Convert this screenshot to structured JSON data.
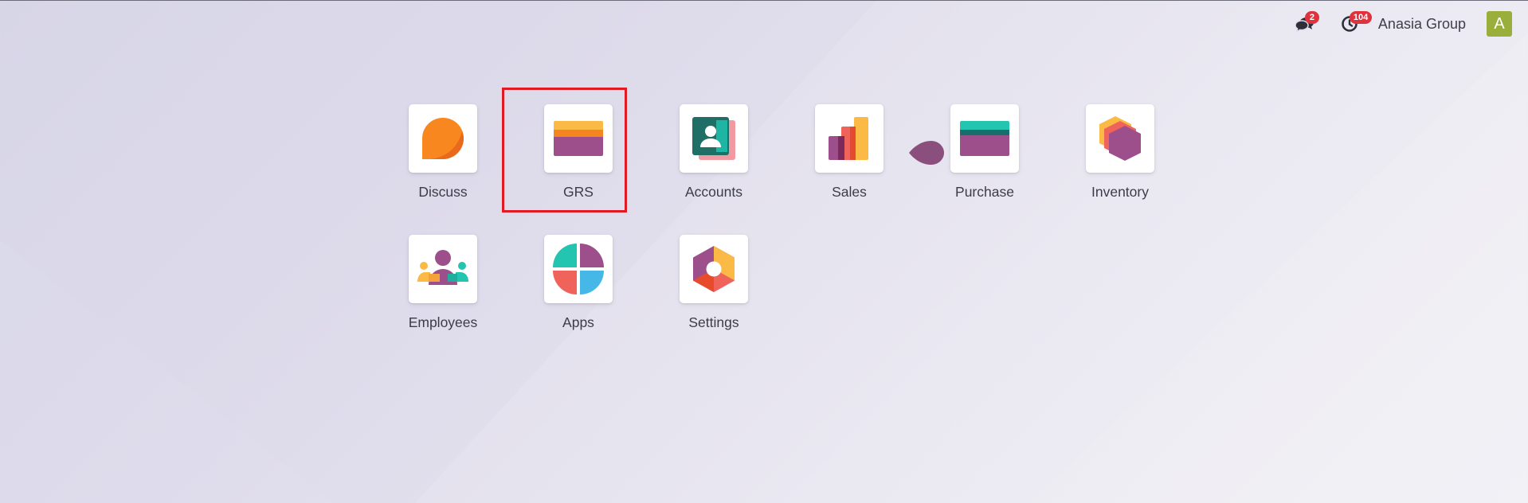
{
  "systray": {
    "messages_badge": "2",
    "activities_badge": "104",
    "company_name": "Anasia Group",
    "avatar_letter": "A",
    "messages_icon": "chat-bubbles-icon",
    "activities_icon": "clock-icon"
  },
  "apps": [
    {
      "label": "Discuss",
      "icon": "discuss-icon"
    },
    {
      "label": "GRS",
      "icon": "grs-card-icon"
    },
    {
      "label": "Accounts",
      "icon": "accounts-contact-icon"
    },
    {
      "label": "Sales",
      "icon": "sales-bars-icon"
    },
    {
      "label": "Purchase",
      "icon": "purchase-card-icon"
    },
    {
      "label": "Inventory",
      "icon": "inventory-cube-icon"
    },
    {
      "label": "Employees",
      "icon": "employees-people-icon"
    },
    {
      "label": "Apps",
      "icon": "apps-quadrant-icon"
    },
    {
      "label": "Settings",
      "icon": "settings-hexagon-icon"
    }
  ],
  "colors": {
    "highlight": "#e01b24",
    "badge": "#e0323d",
    "avatar": "#9aae3c"
  }
}
